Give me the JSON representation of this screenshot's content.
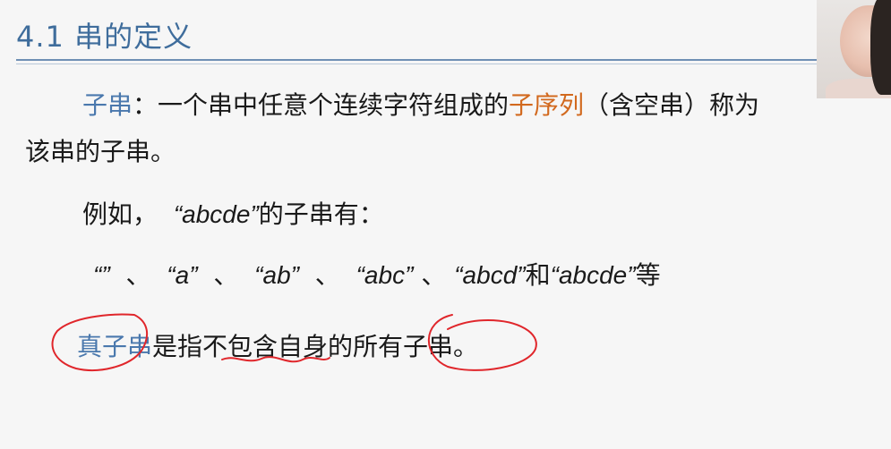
{
  "title": "4.1 串的定义",
  "para1": {
    "term": "子串",
    "part1": "：一个串中任意个连续字符组成的",
    "highlight": "子序列",
    "part2": "（含空串）称为",
    "part3": "该串的子串。"
  },
  "example": {
    "intro_prefix": "例如，",
    "intro_string": "“abcde”",
    "intro_suffix": "的子串有：",
    "list": [
      "“”",
      "、",
      "“a”",
      "、",
      "“ab”",
      "、",
      "“abc”",
      "、",
      "“abcd”",
      "和",
      "“abcde”",
      "等"
    ]
  },
  "proper": {
    "term": "真子串",
    "definition": "是指不包含自身的所有子串。"
  },
  "colors": {
    "title": "#3f6d9c",
    "term": "#4a78ad",
    "highlight": "#d2691e",
    "annotation": "#e0262b"
  }
}
